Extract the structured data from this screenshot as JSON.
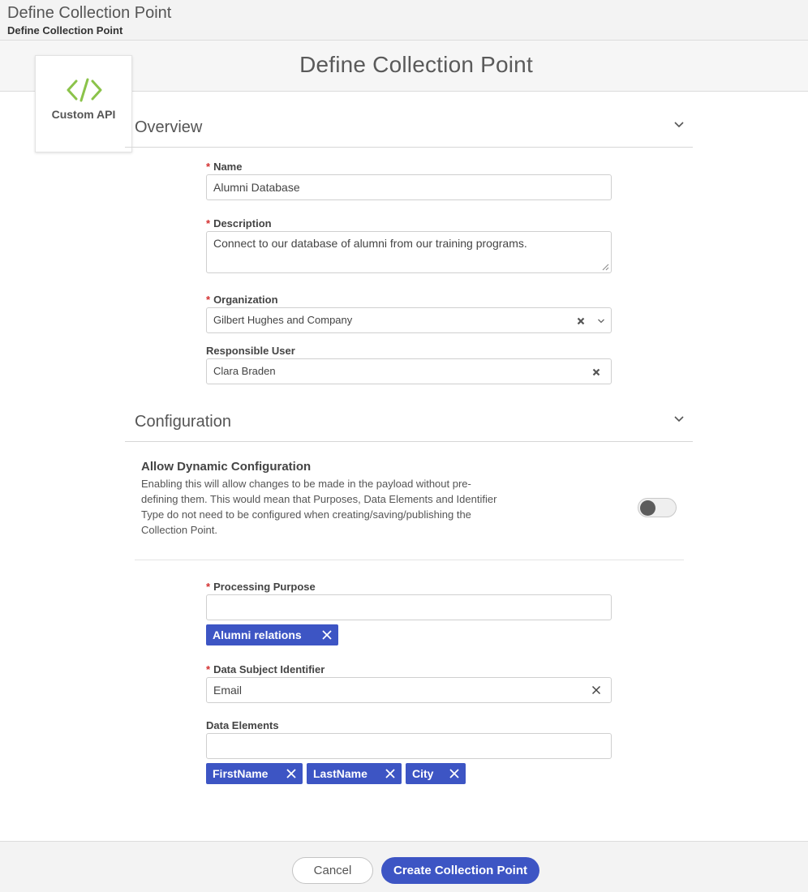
{
  "topbar": {
    "title": "Define Collection Point",
    "breadcrumb": "Define Collection Point"
  },
  "hero": {
    "title": "Define Collection Point"
  },
  "type_card": {
    "label": "Custom API",
    "icon": "code-icon",
    "icon_color": "#8bc34a"
  },
  "overview": {
    "heading": "Overview",
    "name": {
      "label": "Name",
      "value": "Alumni Database"
    },
    "description": {
      "label": "Description",
      "value": "Connect to our database of alumni from our training programs."
    },
    "organization": {
      "label": "Organization",
      "value": "Gilbert Hughes and Company"
    },
    "responsible_user": {
      "label": "Responsible User",
      "value": "Clara Braden"
    }
  },
  "configuration": {
    "heading": "Configuration",
    "dynamic": {
      "title": "Allow Dynamic Configuration",
      "description": "Enabling this will allow changes to be made in the payload without pre-defining them. This would mean that Purposes, Data Elements and Identifier Type do not need to be configured when creating/saving/publishing the Collection Point.",
      "enabled": false
    },
    "processing_purpose": {
      "label": "Processing Purpose",
      "value": "",
      "tags": [
        "Alumni relations"
      ]
    },
    "data_subject_identifier": {
      "label": "Data Subject Identifier",
      "value": "Email"
    },
    "data_elements": {
      "label": "Data Elements",
      "value": "",
      "tags": [
        "FirstName",
        "LastName",
        "City"
      ]
    }
  },
  "footer": {
    "cancel_label": "Cancel",
    "create_label": "Create Collection Point"
  },
  "colors": {
    "accent": "#3d55c4",
    "required": "#d32f2f"
  }
}
